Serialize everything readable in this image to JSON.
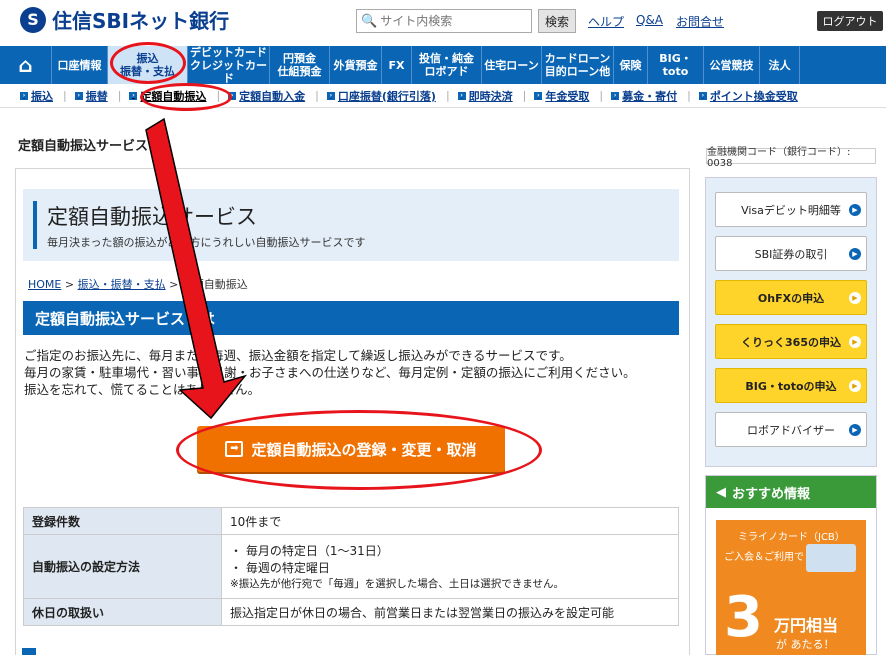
{
  "header": {
    "logo_mark": "S",
    "logo_text": "住信SBIネット銀行",
    "search_placeholder": "サイト内検索",
    "search_button": "検索",
    "links": [
      "ヘルプ",
      "Q&A",
      "お問合せ"
    ],
    "logout": "ログアウト"
  },
  "nav": [
    {
      "label": "⌂",
      "home": true
    },
    {
      "label": "口座情報"
    },
    {
      "label": "振込\n振替・支払",
      "active": true
    },
    {
      "label": "デビットカード\nクレジットカード"
    },
    {
      "label": "円預金\n仕組預金"
    },
    {
      "label": "外貨預金"
    },
    {
      "label": "FX"
    },
    {
      "label": "投信・純金\nロボアド"
    },
    {
      "label": "住宅ローン"
    },
    {
      "label": "カードローン\n目的ローン他"
    },
    {
      "label": "保険"
    },
    {
      "label": "BIG・toto"
    },
    {
      "label": "公営競技"
    },
    {
      "label": "法人"
    }
  ],
  "subnav": [
    "振込",
    "振替",
    "定額自動振込",
    "定額自動入金",
    "口座振替(銀行引落)",
    "即時決済",
    "年金受取",
    "募金・寄付",
    "ポイント換金受取"
  ],
  "subnav_current": "定額自動振込",
  "page_title": "定額自動振込サービス",
  "bank_code": "金融機関コード（銀行コード）: 0038",
  "hero": {
    "title": "定額自動振込サービス",
    "subtitle": "毎月決まった額の振込がある方にうれしい自動振込サービスです"
  },
  "breadcrumb": {
    "home": "HOME",
    "parent": "振込・振替・支払",
    "current": "定額自動振込"
  },
  "section_heading": "定額自動振込サービスとは",
  "description": [
    "ご指定のお振込先に、毎月または毎週、振込金額を指定して繰返し振込みができるサービスです。",
    "毎月の家賃・駐車場代・習い事の月謝・お子さまへの仕送りなど、毎月定例・定額の振込にご利用ください。",
    "振込を忘れて、慌てることはありません。"
  ],
  "cta": {
    "icon": "➡",
    "label": "定額自動振込の登録・変更・取消"
  },
  "table": [
    {
      "head": "登録件数",
      "lines": [
        "10件まで"
      ]
    },
    {
      "head": "自動振込の設定方法",
      "lines": [
        "・ 毎月の特定日（1～31日）",
        "・ 毎週の特定曜日"
      ],
      "note": "※振込先が他行宛で「毎週」を選択した場合、土日は選択できません。"
    },
    {
      "head": "休日の取扱い",
      "lines": [
        "振込指定日が休日の場合、前営業日または翌営業日の振込みを設定可能"
      ]
    }
  ],
  "right_buttons": [
    {
      "label": "Visaデビット明細等",
      "style": "white"
    },
    {
      "label": "SBI証券の取引",
      "style": "white"
    },
    {
      "label": "OhFXの申込",
      "style": "yellow"
    },
    {
      "label": "くりっく365の申込",
      "style": "yellow"
    },
    {
      "label": "BIG・totoの申込",
      "style": "yellow"
    },
    {
      "label": "ロボアドバイザー",
      "style": "white"
    }
  ],
  "recommend": {
    "heading": "おすすめ情報",
    "card_name": "ミライノカード（JCB）",
    "line1": "ご入会＆ご利用で",
    "big": "3",
    "unit": "万円相当",
    "tail": "が あたる！"
  },
  "colors": {
    "brand_blue": "#0a66b5",
    "cta_orange": "#f07000",
    "annotation_red": "#e8141c",
    "yellow_button": "#ffd42a"
  }
}
